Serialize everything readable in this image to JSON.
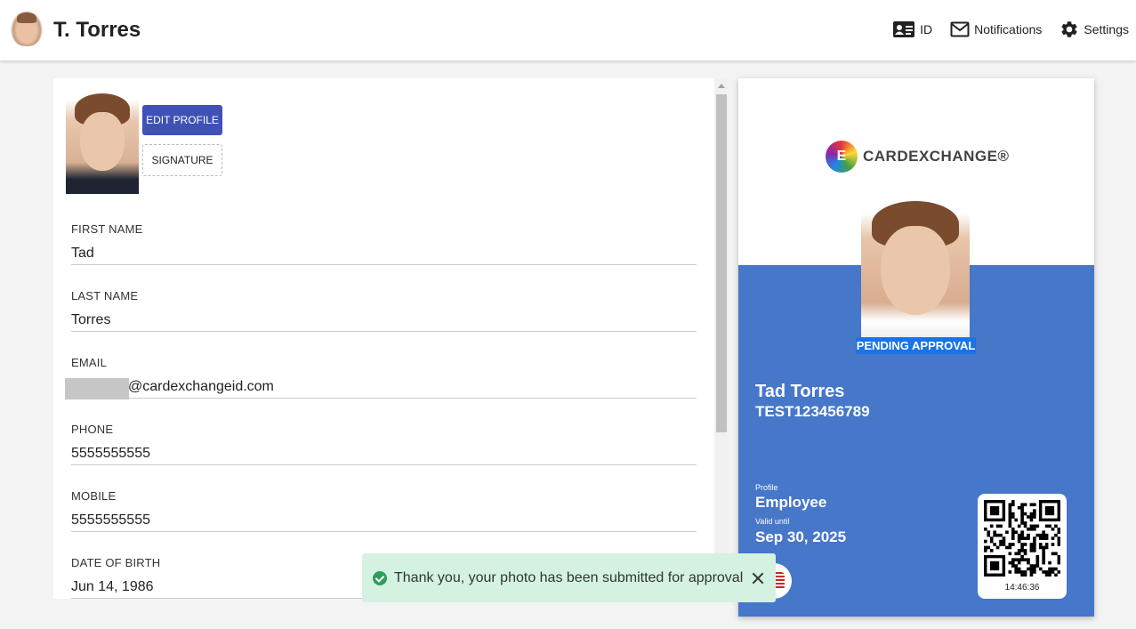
{
  "header": {
    "title": "T. Torres",
    "nav": [
      {
        "label": "ID",
        "icon": "id-card-icon"
      },
      {
        "label": "Notifications",
        "icon": "envelope-icon"
      },
      {
        "label": "Settings",
        "icon": "gear-icon"
      }
    ]
  },
  "profile": {
    "edit_label": "EDIT PROFILE",
    "signature_label": "SIGNATURE",
    "fields": [
      {
        "label": "FIRST NAME",
        "value": "Tad"
      },
      {
        "label": "LAST NAME",
        "value": "Torres"
      },
      {
        "label": "EMAIL",
        "value": "@cardexchangeid.com"
      },
      {
        "label": "PHONE",
        "value": "5555555555"
      },
      {
        "label": "MOBILE",
        "value": "5555555555"
      },
      {
        "label": "DATE OF BIRTH",
        "value": "Jun 14, 1986"
      }
    ]
  },
  "card": {
    "logo_text": "CARDEXCHANGE®",
    "logo_mark": "E",
    "status": "PENDING APPROVAL",
    "name": "Tad Torres",
    "id": "TEST123456789",
    "profile_label": "Profile",
    "profile_value": "Employee",
    "valid_label": "Valid until",
    "valid_value": "Sep 30, 2025",
    "time": "14:46:36",
    "colors": {
      "blue": "#4677c9",
      "pending": "#1a73e8"
    }
  },
  "toast": {
    "message": "Thank you, your photo has been submitted for approval"
  },
  "colors": {
    "primary": "#3f51b5",
    "toast_bg": "#d4f2e2",
    "success": "#2e9e5b"
  }
}
